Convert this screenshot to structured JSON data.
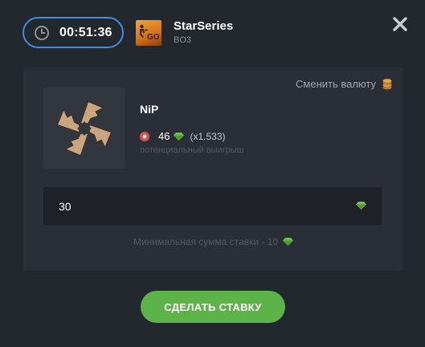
{
  "header": {
    "timer": "00:51:36",
    "tournament_name": "StarSeries",
    "tournament_format": "BO3",
    "game_logo_text": "GO"
  },
  "bet": {
    "change_currency_label": "Сменить валюту",
    "team_name": "NiP",
    "potential_win_amount": "46",
    "coefficient": "(x1.533)",
    "potential_win_caption": "потенциальный выигрыш",
    "input_value": "30",
    "min_bet_text": "Минимальная сумма ставки - 10"
  },
  "actions": {
    "submit_label": "СДЕЛАТЬ СТАВКУ"
  },
  "colors": {
    "background": "#23272e",
    "card": "#2a2f37",
    "accent_blue": "#3d8fe0",
    "submit_green": "#5cb347",
    "gem_green": "#6fc24a",
    "coin_gold": "#d9953b"
  },
  "icons": [
    "clock-icon",
    "game-logo",
    "close-icon",
    "coins-icon",
    "team-logo",
    "gem-icon"
  ]
}
